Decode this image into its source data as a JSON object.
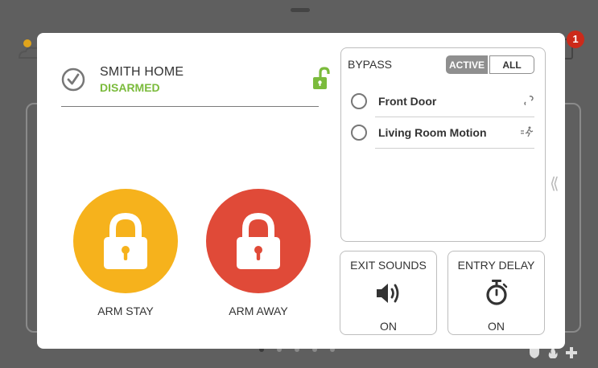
{
  "background": {
    "notification_count": "1",
    "page_dots": 5,
    "active_dot": 0
  },
  "panel": {
    "system_name": "SMITH HOME",
    "status": "DISARMED",
    "status_color": "#7bbb3c"
  },
  "arm_buttons": {
    "stay_label": "ARM STAY",
    "stay_color": "#f6b21c",
    "away_label": "ARM AWAY",
    "away_color": "#e04a38"
  },
  "bypass": {
    "title": "BYPASS",
    "filter_active_label": "ACTIVE",
    "filter_all_label": "ALL",
    "zones": [
      {
        "name": "Front Door",
        "icon": "door-contact-icon"
      },
      {
        "name": "Living Room Motion",
        "icon": "motion-sensor-icon"
      }
    ]
  },
  "options": {
    "exit_sounds": {
      "title": "EXIT SOUNDS",
      "value": "ON",
      "icon": "speaker-icon"
    },
    "entry_delay": {
      "title": "ENTRY DELAY",
      "value": "ON",
      "icon": "stopwatch-icon"
    }
  }
}
